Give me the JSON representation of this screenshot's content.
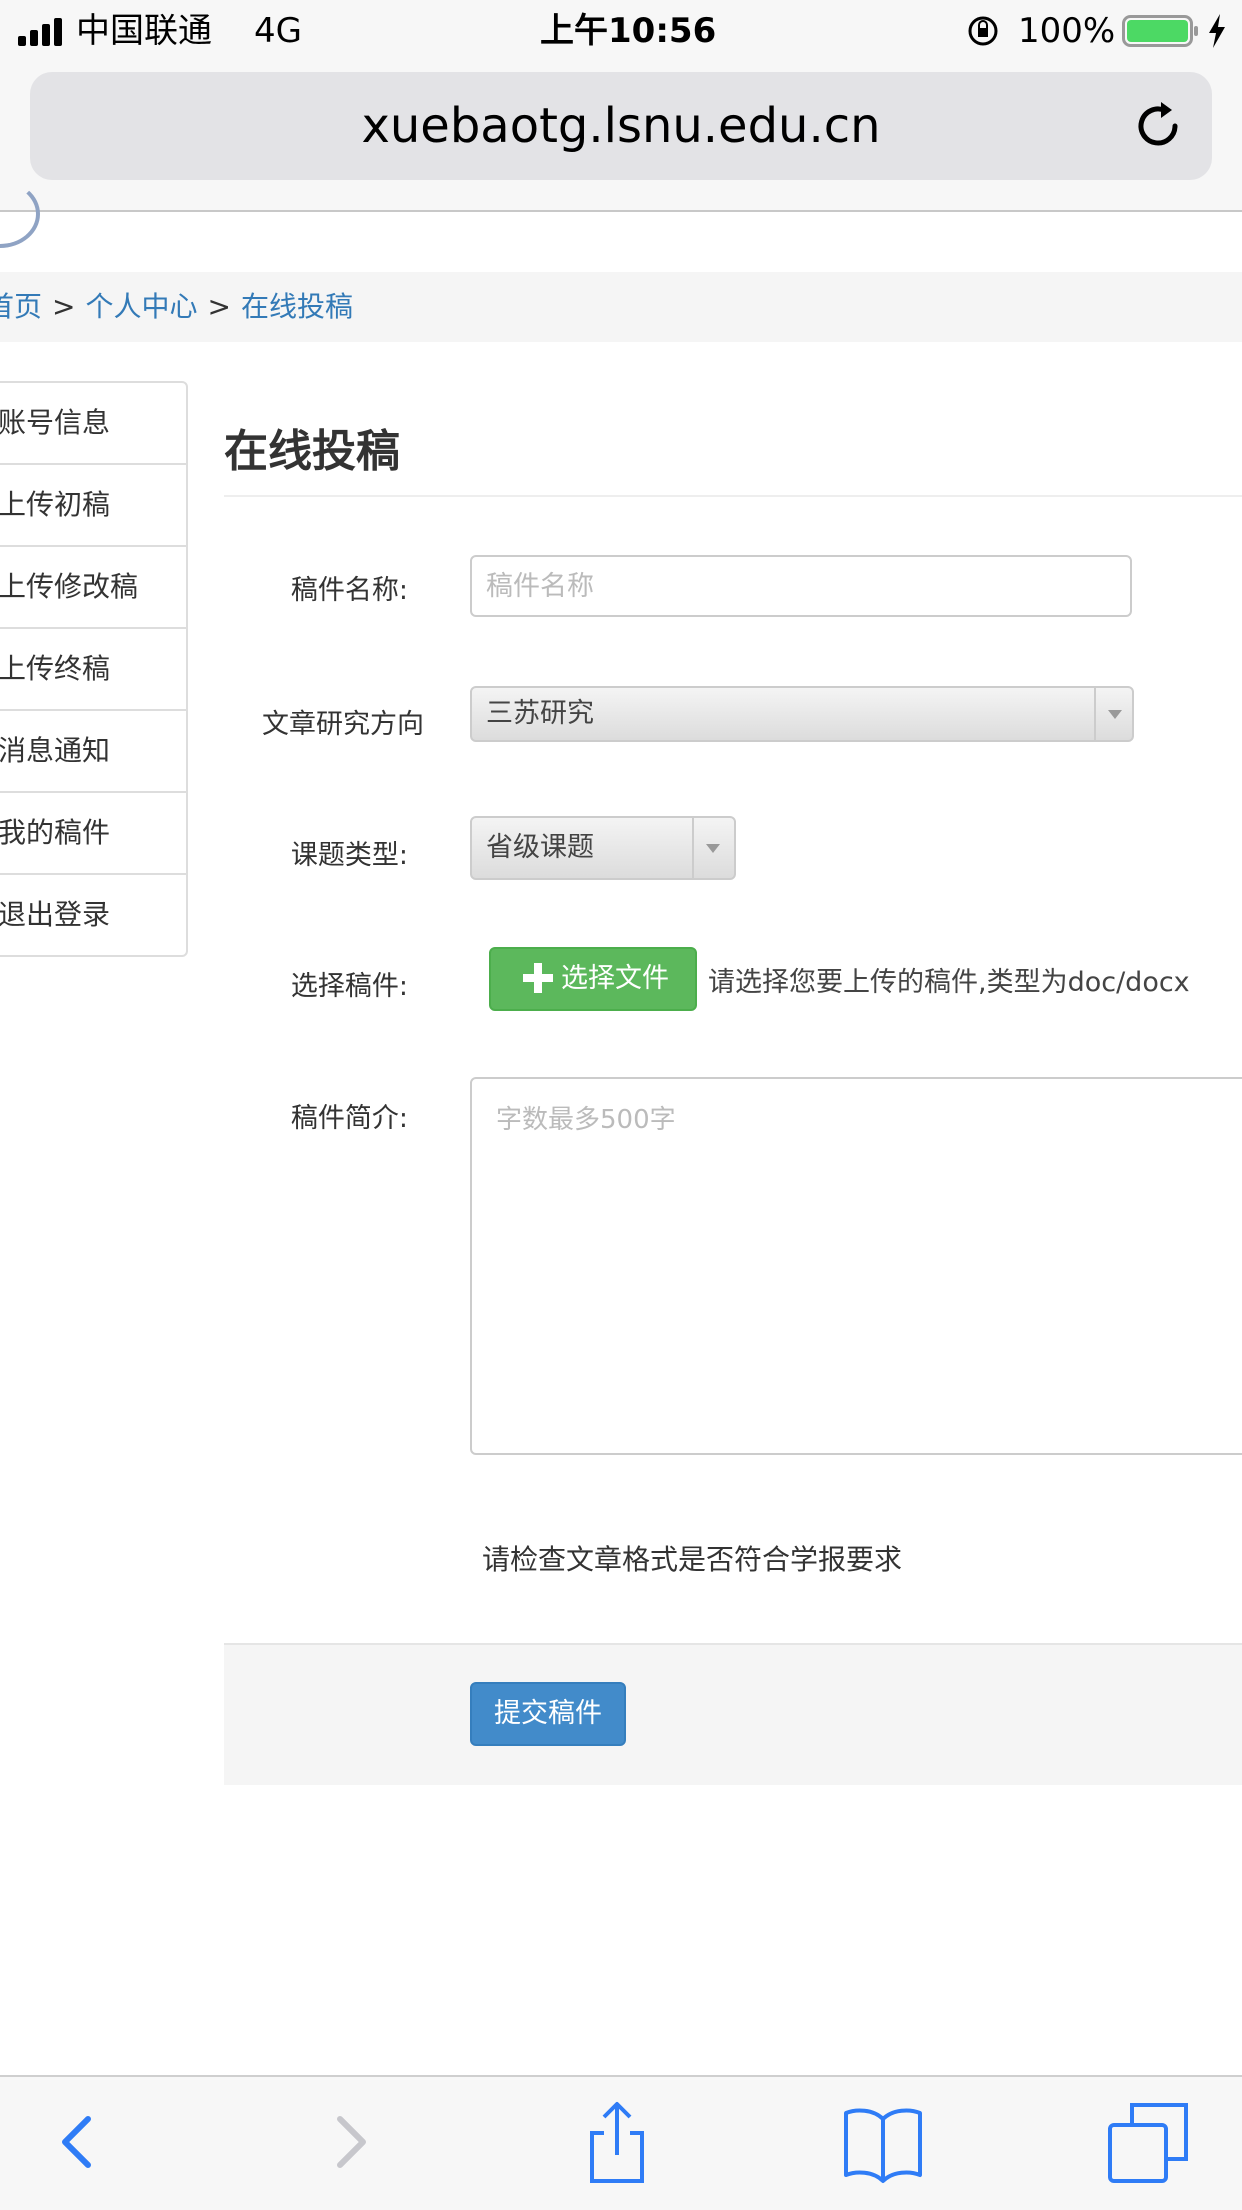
{
  "status_bar": {
    "carrier": "中国联通",
    "network": "4G",
    "time": "上午10:56",
    "battery": "100%"
  },
  "browser": {
    "url": "xuebaotg.lsnu.edu.cn"
  },
  "breadcrumb": {
    "items": [
      "首页",
      "个人中心",
      "在线投稿"
    ],
    "separator": ">"
  },
  "sidebar": {
    "items": [
      {
        "label": "账号信息"
      },
      {
        "label": "上传初稿"
      },
      {
        "label": "上传修改稿"
      },
      {
        "label": "上传终稿"
      },
      {
        "label": "消息通知"
      },
      {
        "label": "我的稿件"
      },
      {
        "label": "退出登录"
      }
    ]
  },
  "form": {
    "title": "在线投稿",
    "manuscript_name": {
      "label": "稿件名称:",
      "placeholder": "稿件名称",
      "value": ""
    },
    "research_direction": {
      "label": "文章研究方向",
      "selected": "三苏研究"
    },
    "project_type": {
      "label": "课题类型:",
      "selected": "省级课题"
    },
    "file": {
      "label": "选择稿件:",
      "button": "选择文件",
      "hint": "请选择您要上传的稿件,类型为doc/docx"
    },
    "abstract": {
      "label": "稿件简介:",
      "placeholder": "字数最多500字",
      "value": ""
    },
    "notice": "请检查文章格式是否符合学报要求",
    "submit": "提交稿件"
  },
  "colors": {
    "link": "#337ab7",
    "success_button": "#5cb85c",
    "primary_button": "#428bca",
    "ios_blue": "#2f7cf6"
  },
  "toolbar": {
    "icons": [
      "back-icon",
      "forward-icon",
      "share-icon",
      "bookmarks-icon",
      "tabs-icon"
    ]
  }
}
